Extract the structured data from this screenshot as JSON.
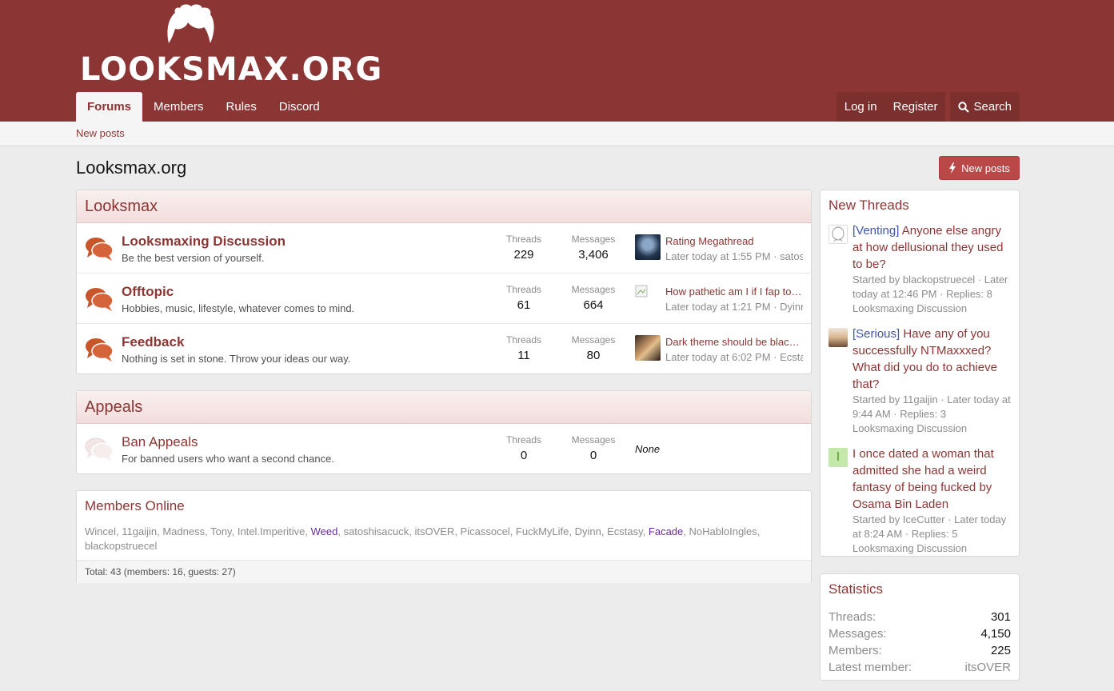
{
  "site": {
    "logo_text": "LOOKSMAX.ORG"
  },
  "nav": {
    "tabs": [
      {
        "label": "Forums",
        "active": true
      },
      {
        "label": "Members"
      },
      {
        "label": "Rules"
      },
      {
        "label": "Discord"
      }
    ],
    "login": "Log in",
    "register": "Register",
    "search": "Search"
  },
  "subnav": {
    "new_posts": "New posts"
  },
  "page": {
    "title": "Looksmax.org",
    "new_posts_button": "New posts"
  },
  "categories": [
    {
      "title": "Looksmax",
      "nodes": [
        {
          "title": "Looksmaxing Discussion",
          "desc": "Be the best version of yourself.",
          "threads_label": "Threads",
          "threads": "229",
          "messages_label": "Messages",
          "messages": "3,406",
          "latest_title": "Rating Megathread",
          "latest_meta": "Later today at 1:55 PM · satos"
        },
        {
          "title": "Offtopic",
          "desc": "Hobbies, music, lifestyle, whatever comes to mind.",
          "threads_label": "Threads",
          "threads": "61",
          "messages_label": "Messages",
          "messages": "664",
          "latest_title": "How pathetic am I if I fap to…",
          "latest_meta": "Later today at 1:21 PM · Dyinn"
        },
        {
          "title": "Feedback",
          "desc": "Nothing is set in stone. Throw your ideas our way.",
          "threads_label": "Threads",
          "threads": "11",
          "messages_label": "Messages",
          "messages": "80",
          "latest_title": "Dark theme should be blac…",
          "latest_meta": "Later today at 6:02 PM · Ecsta"
        }
      ]
    },
    {
      "title": "Appeals",
      "nodes": [
        {
          "title": "Ban Appeals",
          "desc": "For banned users who want a second chance.",
          "threads_label": "Threads",
          "threads": "0",
          "messages_label": "Messages",
          "messages": "0",
          "latest_none": "None"
        }
      ]
    }
  ],
  "members_online": {
    "title": "Members Online",
    "users": [
      "Wincel",
      "11gaijin",
      "Madness",
      "Tony",
      "Intel.Imperitive",
      "Weed",
      "satoshisacuck",
      "itsOVER",
      "Picassocel",
      "FuckMyLife",
      "Dyinn",
      "Ecstasy",
      "Facade",
      "NoHabloIngles",
      "blackopstruecel"
    ],
    "total": "Total: 43 (members: 16, guests: 27)"
  },
  "new_threads": {
    "title": "New Threads",
    "items": [
      {
        "prefix": "[Venting]",
        "title": "Anyone else angry at how dellusional they used to be?",
        "meta1": "Started by blackopstruecel · Later today at 12:46 PM · Replies: 8",
        "forum": "Looksmaxing Discussion"
      },
      {
        "prefix": "[Serious]",
        "title": "Have any of you successfully NTMaxxxed? What did you do to achieve that?",
        "meta1": "Started by 11gaijin · Later today at 9:44 AM · Replies: 3",
        "forum": "Looksmaxing Discussion"
      },
      {
        "avatar_letter": "I",
        "title": "I once dated a woman that admitted she had a weird fantasy of being fucked by Osama Bin Laden",
        "meta1": "Started by IceCutter · Later today at 8:24 AM · Replies: 5",
        "forum": "Looksmaxing Discussion"
      }
    ]
  },
  "statistics": {
    "title": "Statistics",
    "rows": [
      {
        "k": "Threads:",
        "v": "301"
      },
      {
        "k": "Messages:",
        "v": "4,150"
      },
      {
        "k": "Members:",
        "v": "225"
      },
      {
        "k": "Latest member:",
        "v": "itsOVER"
      }
    ]
  },
  "colors": {
    "brand": "#8b3634",
    "button": "#b94846",
    "link": "#8b3634",
    "prefix_blue": "#4055a8"
  }
}
